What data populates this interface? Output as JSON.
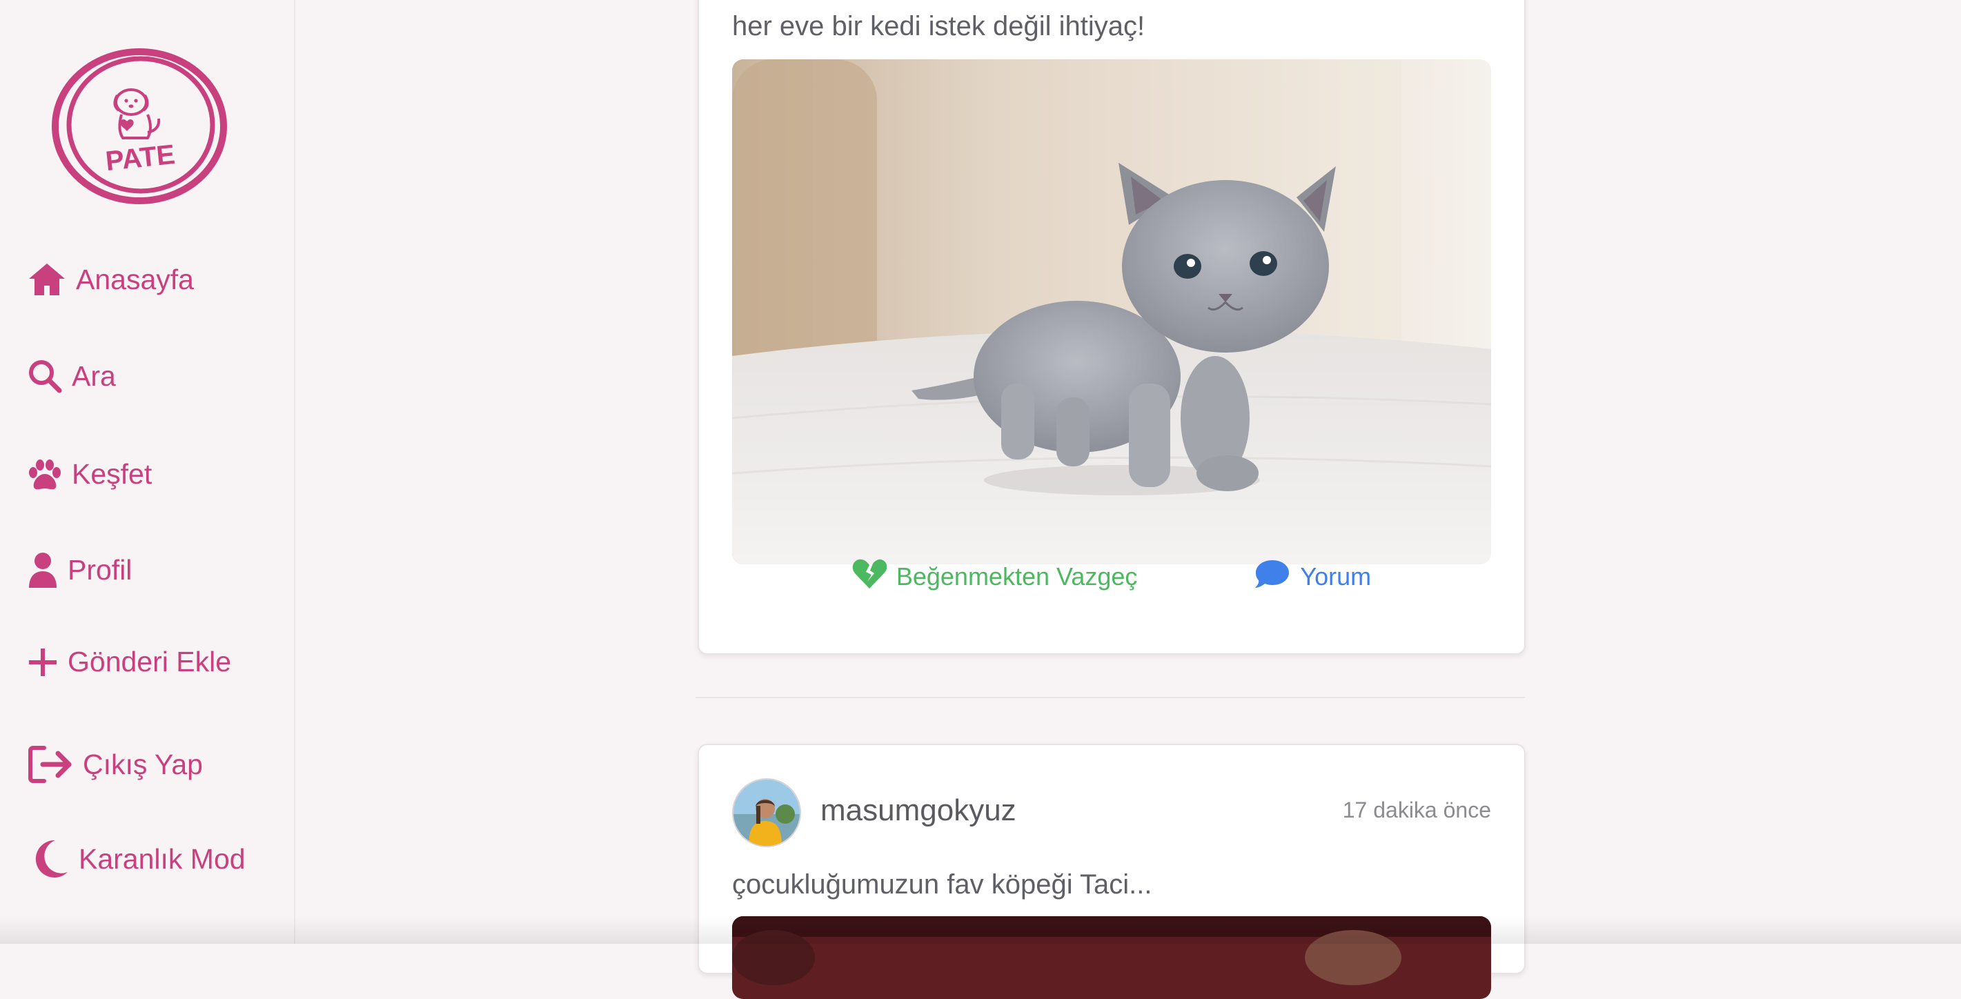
{
  "app": {
    "logo_text": "PATE",
    "brand_color": "#c9407e"
  },
  "sidebar": {
    "items": [
      {
        "label": "Anasayfa",
        "icon": "home-icon"
      },
      {
        "label": "Ara",
        "icon": "search-icon"
      },
      {
        "label": "Keşfet",
        "icon": "paw-icon"
      },
      {
        "label": "Profil",
        "icon": "user-icon"
      },
      {
        "label": "Gönderi Ekle",
        "icon": "plus-icon"
      },
      {
        "label": "Çıkış Yap",
        "icon": "logout-icon"
      },
      {
        "label": "Karanlık Mod",
        "icon": "moon-icon"
      }
    ]
  },
  "feed": {
    "posts": [
      {
        "caption": "her eve bir kedi istek değil ihtiyaç!",
        "image": "kitten-photo",
        "actions": {
          "unlike_label": "Beğenmekten Vazgeç",
          "unlike_icon": "heart-broken-icon",
          "unlike_color": "#4cb860",
          "comment_label": "Yorum",
          "comment_icon": "comment-icon",
          "comment_color": "#3f80ea"
        }
      },
      {
        "username": "masumgokyuz",
        "time": "17 dakika önce",
        "caption": "çocukluğumuzun fav köpeği Taci...",
        "image": "dog-photo"
      }
    ]
  }
}
